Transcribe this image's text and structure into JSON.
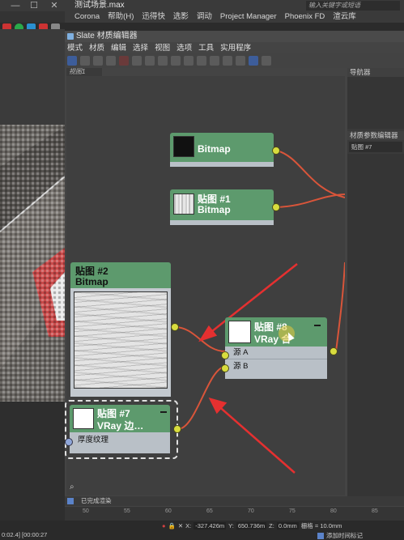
{
  "host": {
    "file_title": "测试场景.max",
    "search_placeholder": "输入关键字或短语",
    "menu": [
      "Corona",
      "帮助(H)",
      "迅得快",
      "选影",
      "调动",
      "Project Manager",
      "Phoenix FD",
      "渲云库"
    ],
    "time_readout": "0:02.4] [00:00:27"
  },
  "slate": {
    "title": "Slate 材质编辑器",
    "menu": [
      "模式",
      "材质",
      "编辑",
      "选择",
      "视图",
      "选项",
      "工具",
      "实用程序"
    ],
    "view_tab": "视图1",
    "navigator_header": "导航器",
    "param_editor_header": "材质参数编辑器",
    "param_value": "贴图 #7",
    "status": "已完成渲染",
    "colors": {
      "node_header": "#5d9a6d",
      "node_body": "#b9c0c7",
      "socket": "#d8dc3e",
      "wire": "#d9553a",
      "arrow": "#e53030"
    }
  },
  "nodes": {
    "bitmap_top": {
      "title": "Bitmap"
    },
    "map1": {
      "line1": "贴图 #1",
      "line2": "Bitmap"
    },
    "map2": {
      "line1": "贴图 #2",
      "line2": "Bitmap"
    },
    "map8": {
      "line1": "贴图 #8",
      "line2": "VRay 合",
      "port_a": "源 A",
      "port_b": "源 B"
    },
    "map7": {
      "line1": "贴图 #7",
      "line2": "VRay 边…",
      "port": "厚度纹理"
    }
  },
  "timeline": {
    "ruler": [
      "50",
      "55",
      "60",
      "65",
      "70",
      "75",
      "80",
      "85"
    ],
    "x_label": "X:",
    "x_value": "-327.426m",
    "y_label": "Y:",
    "y_value": "650.736m",
    "z_label": "Z:",
    "z_value": "0.0mm",
    "grid": "栅格 = 10.0mm",
    "add_key": "添加时间标记"
  }
}
